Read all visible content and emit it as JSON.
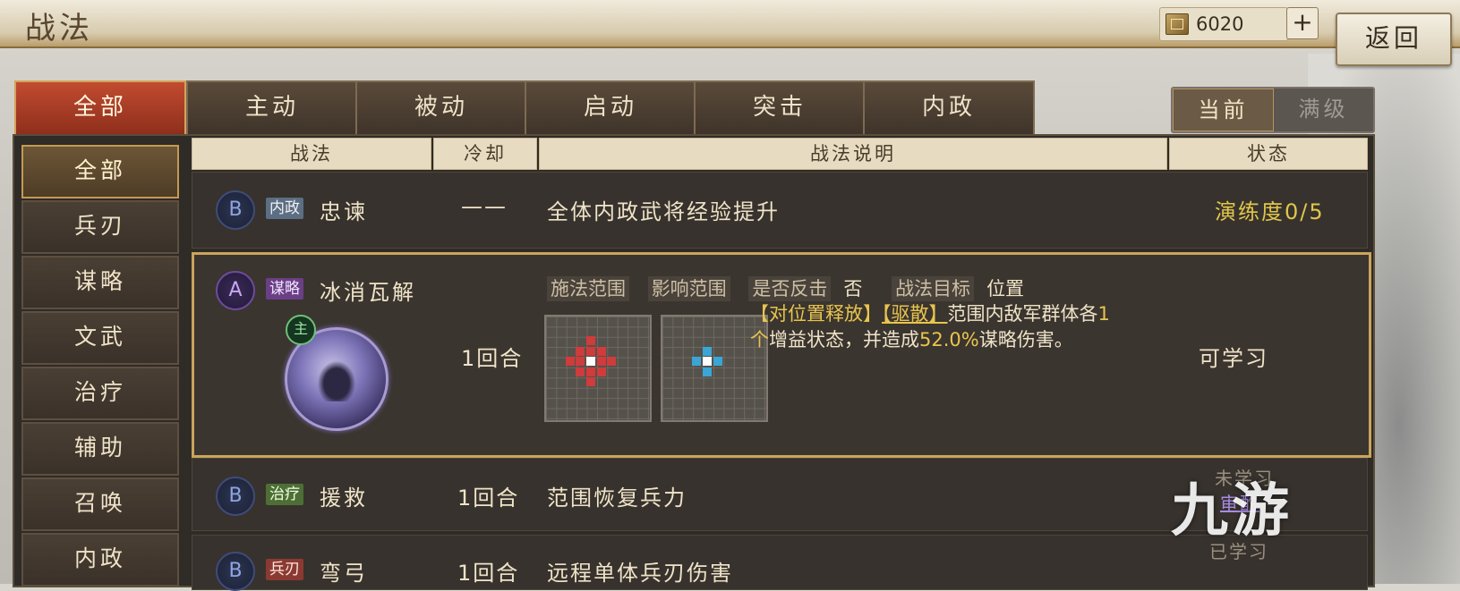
{
  "title": "战法",
  "currency": {
    "value": "6020",
    "icon": "scroll-coin-icon"
  },
  "buttons": {
    "plus": "+",
    "back": "返回"
  },
  "tabs": [
    "全部",
    "主动",
    "被动",
    "启动",
    "突击",
    "内政"
  ],
  "active_tab": "全部",
  "level_toggle": {
    "current": "当前",
    "max": "满级"
  },
  "sidebar": [
    "全部",
    "兵刃",
    "谋略",
    "文武",
    "治疗",
    "辅助",
    "召唤",
    "内政"
  ],
  "table_headers": {
    "skill": "战法",
    "cooldown": "冷却",
    "description": "战法说明",
    "status": "状态"
  },
  "rows": [
    {
      "grade": "B",
      "tag": "内政",
      "name": "忠谏",
      "cooldown": "——",
      "description": "全体内政武将经验提升",
      "status": "演练度0/5"
    },
    {
      "grade": "A",
      "tag": "谋略",
      "name": "冰消瓦解",
      "cooldown": "1回合",
      "range_labels": {
        "cast_range": "施法范围",
        "affect_range": "影响范围",
        "counter": "是否反击",
        "counter_value": "否",
        "target": "战法目标",
        "target_value": "位置"
      },
      "desc_hl1": "【对位置释放】",
      "desc_hl2": "【驱散】",
      "desc_p1": "范围内敌军群体各",
      "desc_hl3": "1个",
      "desc_p2": "增益状态，并造成",
      "desc_hl4": "52.0%",
      "desc_p3": "谋略伤害。",
      "main_badge": "主",
      "status": "可学习"
    },
    {
      "grade": "B",
      "tag": "治疗",
      "name": "援救",
      "cooldown": "1回合",
      "description": "范围恢复兵力",
      "status": "未学习",
      "status2": "审酌"
    },
    {
      "grade": "B",
      "tag": "兵刃",
      "name": "弯弓",
      "cooldown": "1回合",
      "description": "远程单体兵刃伤害",
      "status": "已学习"
    }
  ],
  "watermark": "九游",
  "colors": {
    "accent_gold": "#c9a55c",
    "active_tab_red": "#c14b30",
    "highlight_yellow": "#e8c54e",
    "range_red": "#d03b3b",
    "range_blue": "#3aa6d6"
  }
}
